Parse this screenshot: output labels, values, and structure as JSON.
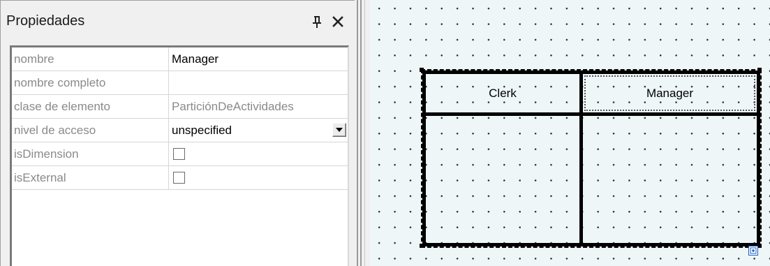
{
  "panel": {
    "title": "Propiedades",
    "pin_icon": "pin-icon",
    "close_icon": "close-icon",
    "rows": [
      {
        "name": "nombre",
        "value": "Manager",
        "kind": "text"
      },
      {
        "name": "nombre completo",
        "value": "",
        "kind": "text"
      },
      {
        "name": "clase de elemento",
        "value": "ParticiónDeActividades",
        "kind": "readonly"
      },
      {
        "name": "nivel de acceso",
        "value": "unspecified",
        "kind": "dropdown"
      },
      {
        "name": "isDimension",
        "checked": false,
        "kind": "checkbox"
      },
      {
        "name": "isExternal",
        "checked": false,
        "kind": "checkbox"
      }
    ]
  },
  "diagram": {
    "partitions": [
      "Clerk",
      "Manager"
    ],
    "selected_partition": "Manager"
  },
  "colors": {
    "panel_bg": "#f0f0f0",
    "canvas_bg": "#eef6f8",
    "label_gray": "#8a8a8a"
  }
}
